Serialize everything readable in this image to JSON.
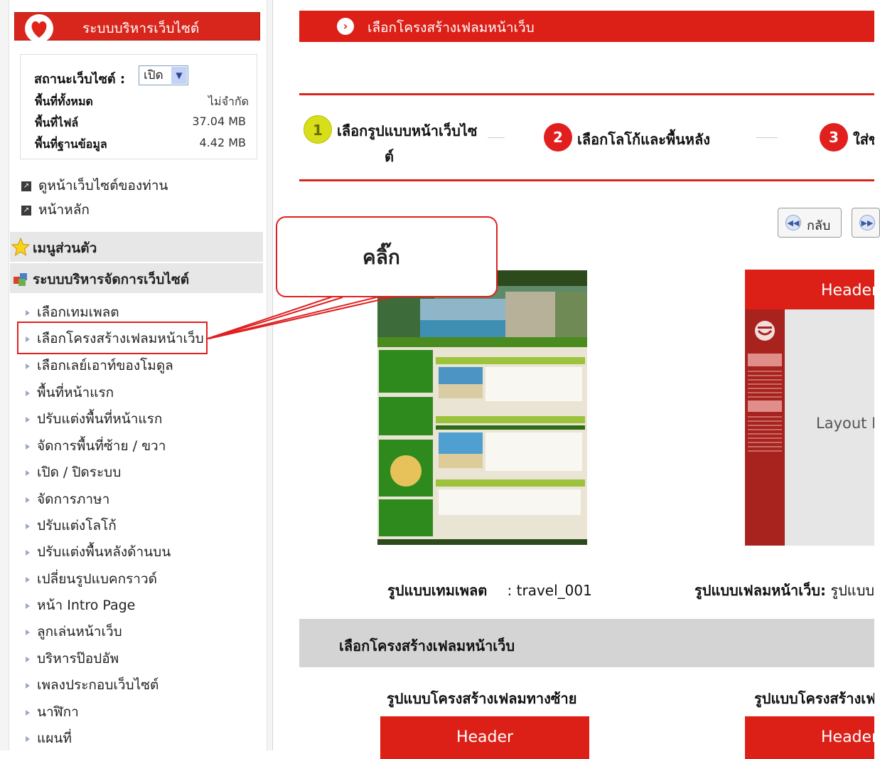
{
  "sidebar": {
    "title": "ระบบบริหารเว็บไซต์",
    "status": {
      "label": "สถานะเว็บไซต์ :",
      "value": "เปิด",
      "rows": [
        {
          "label": "พื้นที่ทั้งหมด",
          "value": "ไม่จำกัด"
        },
        {
          "label": "พื้นที่ไฟล์",
          "value": "37.04 MB"
        },
        {
          "label": "พื้นที่ฐานข้อมูล",
          "value": "4.42 MB"
        }
      ]
    },
    "links": [
      "ดูหน้าเว็บไซต์ของท่าน",
      "หน้าหลัก"
    ],
    "sections": [
      "เมนูส่วนตัว",
      "ระบบบริหารจัดการเว็บไซต์"
    ],
    "menu": [
      "เลือกเทมเพลต",
      "เลือกโครงสร้างเฟลมหน้าเว็บ",
      "เลือกเลย์เอาท์ของโมดูล",
      "พื้นที่หน้าแรก",
      "ปรับแต่งพื้นที่หน้าแรก",
      "จัดการพื้นที่ซ้าย / ขวา",
      "เปิด / ปิดระบบ",
      "จัดการภาษา",
      "ปรับแต่งโลโก้",
      "ปรับแต่งพื้นหลังด้านบน",
      "เปลี่ยนรูปแบคกราวด์",
      "หน้า Intro Page",
      "ลูกเล่นหน้าเว็บ",
      "บริหารป๊อปอัพ",
      "เพลงประกอบเว็บไซต์",
      "นาฬิกา",
      "แผนที่"
    ]
  },
  "main": {
    "header": "เลือกโครงสร้างเฟลมหน้าเว็บ",
    "steps": [
      {
        "num": "1",
        "label_line1": "เลือกรูปแบบหน้าเว็บไซ",
        "label_line2": "ต์"
      },
      {
        "num": "2",
        "label_line1": "เลือกโลโก้และพื้นหลัง",
        "label_line2": ""
      },
      {
        "num": "3",
        "label_line1": "ใส่ข",
        "label_line2": ""
      }
    ],
    "back_button": "กลับ",
    "callout": "คลิ๊ก",
    "template_caption_label": "รูปแบบเทมเพลต",
    "template_caption_value": ": travel_001",
    "layout_caption_label": "รูปแบบเฟลมหน้าเว็บ:",
    "layout_caption_value": "รูปแบบโ",
    "layout_preview_header": "Header",
    "layout_preview_body": "Layout M",
    "section_title": "เลือกโครงสร้างเฟลมหน้าเว็บ",
    "options": [
      {
        "caption": "รูปแบบโครงสร้างเฟลมทางซ้าย",
        "header": "Header"
      },
      {
        "caption": "รูปแบบโครงสร้างเฟ",
        "header": "Header"
      }
    ]
  },
  "colors": {
    "accent_red": "#dc2018",
    "step1_yellow": "#d6df1a",
    "gray_bar": "#d4d4d4"
  }
}
